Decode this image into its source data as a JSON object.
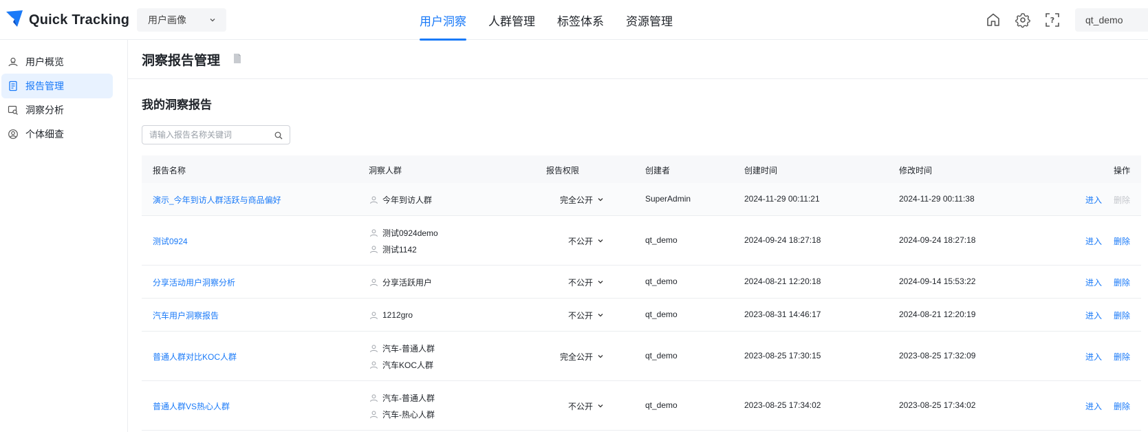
{
  "header": {
    "logo_text": "Quick Tracking",
    "app_switch": "用户画像",
    "nav_tabs": [
      {
        "label": "用户洞察",
        "active": true
      },
      {
        "label": "人群管理",
        "active": false
      },
      {
        "label": "标签体系",
        "active": false
      },
      {
        "label": "资源管理",
        "active": false
      }
    ],
    "icons": [
      "home-icon",
      "gear-icon",
      "help-scan-icon"
    ],
    "username": "qt_demo"
  },
  "sidebar": {
    "items": [
      {
        "label": "用户概览",
        "icon": "user-overview-icon",
        "active": false
      },
      {
        "label": "报告管理",
        "icon": "report-icon",
        "active": true
      },
      {
        "label": "洞察分析",
        "icon": "insight-analysis-icon",
        "active": false
      },
      {
        "label": "个体细查",
        "icon": "individual-icon",
        "active": false
      }
    ]
  },
  "main": {
    "page_title": "洞察报告管理",
    "section_title": "我的洞察报告",
    "search": {
      "placeholder": "请输入报告名称关键词",
      "value": ""
    },
    "table": {
      "columns": [
        "报告名称",
        "洞察人群",
        "报告权限",
        "创建者",
        "创建时间",
        "修改时间",
        "操作"
      ],
      "rows": [
        {
          "name": "演示_今年到访人群活跃与商品偏好",
          "crowds": [
            "今年到访人群"
          ],
          "permission": "完全公开",
          "creator": "SuperAdmin",
          "created": "2024-11-29 00:11:21",
          "modified": "2024-11-29 00:11:38",
          "enter": "进入",
          "delete": "删除",
          "delete_disabled": true
        },
        {
          "name": "测试0924",
          "crowds": [
            "测试0924demo",
            "测试1142"
          ],
          "permission": "不公开",
          "creator": "qt_demo",
          "created": "2024-09-24 18:27:18",
          "modified": "2024-09-24 18:27:18",
          "enter": "进入",
          "delete": "删除",
          "delete_disabled": false
        },
        {
          "name": "分享活动用户洞察分析",
          "crowds": [
            "分享活跃用户"
          ],
          "permission": "不公开",
          "creator": "qt_demo",
          "created": "2024-08-21 12:20:18",
          "modified": "2024-09-14 15:53:22",
          "enter": "进入",
          "delete": "删除",
          "delete_disabled": false
        },
        {
          "name": "汽车用户洞察报告",
          "crowds": [
            "1212gro"
          ],
          "permission": "不公开",
          "creator": "qt_demo",
          "created": "2023-08-31 14:46:17",
          "modified": "2024-08-21 12:20:19",
          "enter": "进入",
          "delete": "删除",
          "delete_disabled": false
        },
        {
          "name": "普通人群对比KOC人群",
          "crowds": [
            "汽车-普通人群",
            "汽车KOC人群"
          ],
          "permission": "完全公开",
          "creator": "qt_demo",
          "created": "2023-08-25 17:30:15",
          "modified": "2023-08-25 17:32:09",
          "enter": "进入",
          "delete": "删除",
          "delete_disabled": false
        },
        {
          "name": "普通人群VS热心人群",
          "crowds": [
            "汽车-普通人群",
            "汽车-热心人群"
          ],
          "permission": "不公开",
          "creator": "qt_demo",
          "created": "2023-08-25 17:34:02",
          "modified": "2023-08-25 17:34:02",
          "enter": "进入",
          "delete": "删除",
          "delete_disabled": false
        }
      ]
    }
  },
  "colors": {
    "accent": "#1a7af8",
    "active_bg": "#e8f2ff",
    "disabled": "#c4c7cc"
  }
}
